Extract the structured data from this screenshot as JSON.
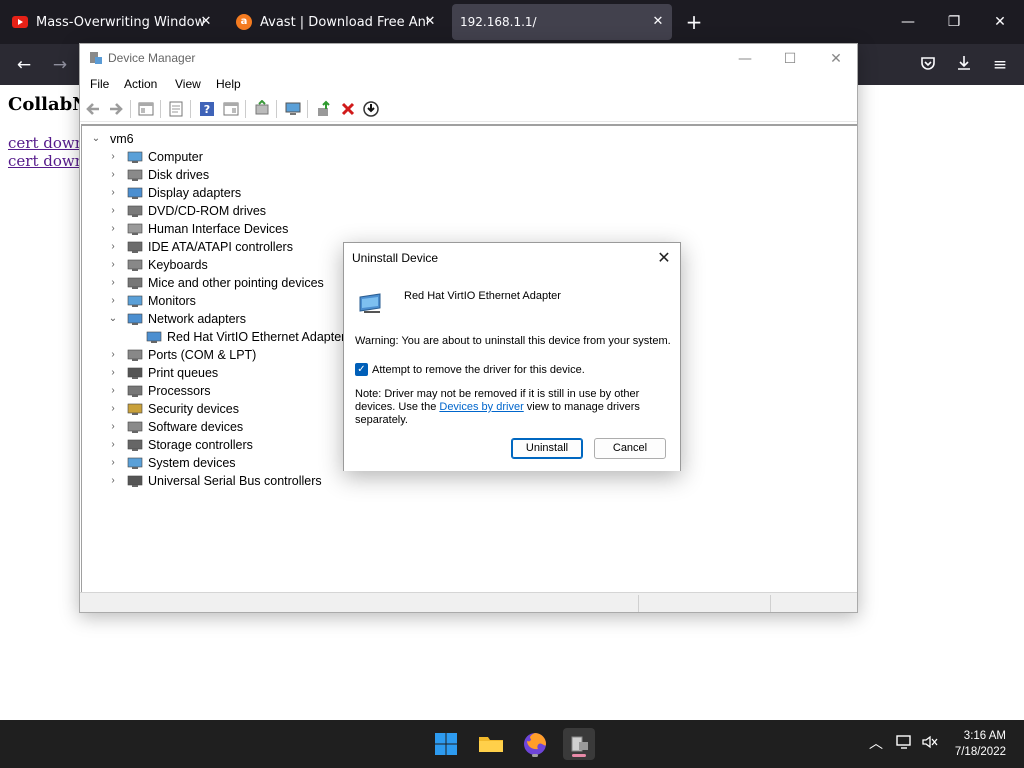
{
  "browser": {
    "tabs": [
      {
        "title": "Mass-Overwriting Windows Re",
        "icon": "youtube-icon"
      },
      {
        "title": "Avast | Download Free Antivirus",
        "icon": "avast-icon"
      },
      {
        "title": "192.168.1.1/",
        "icon": "none"
      }
    ]
  },
  "page": {
    "title": "CollabNe",
    "links": [
      "cert downlo",
      "cert downlo"
    ]
  },
  "device_manager": {
    "title": "Device Manager",
    "menu": [
      "File",
      "Action",
      "View",
      "Help"
    ],
    "root": "vm6",
    "categories": [
      {
        "label": "Computer",
        "expanded": false
      },
      {
        "label": "Disk drives",
        "expanded": false
      },
      {
        "label": "Display adapters",
        "expanded": false
      },
      {
        "label": "DVD/CD-ROM drives",
        "expanded": false
      },
      {
        "label": "Human Interface Devices",
        "expanded": false
      },
      {
        "label": "IDE ATA/ATAPI controllers",
        "expanded": false
      },
      {
        "label": "Keyboards",
        "expanded": false
      },
      {
        "label": "Mice and other pointing devices",
        "expanded": false
      },
      {
        "label": "Monitors",
        "expanded": false
      },
      {
        "label": "Network adapters",
        "expanded": true
      },
      {
        "label": "Red Hat VirtIO Ethernet Adapter",
        "child": true
      },
      {
        "label": "Ports (COM & LPT)",
        "expanded": false
      },
      {
        "label": "Print queues",
        "expanded": false
      },
      {
        "label": "Processors",
        "expanded": false
      },
      {
        "label": "Security devices",
        "expanded": false
      },
      {
        "label": "Software devices",
        "expanded": false
      },
      {
        "label": "Storage controllers",
        "expanded": false
      },
      {
        "label": "System devices",
        "expanded": false
      },
      {
        "label": "Universal Serial Bus controllers",
        "expanded": false
      }
    ]
  },
  "dialog": {
    "title": "Uninstall Device",
    "device_name": "Red Hat VirtIO Ethernet Adapter",
    "warning": "Warning: You are about to uninstall this device from your system.",
    "checkbox_label": "Attempt to remove the driver for this device.",
    "checkbox_checked": true,
    "note_before": "Note: Driver may not be removed if it is still in use by other devices. Use the ",
    "note_link": "Devices by driver",
    "note_after": " view to manage drivers separately.",
    "uninstall_label": "Uninstall",
    "cancel_label": "Cancel"
  },
  "taskbar": {
    "time": "3:16 AM",
    "date": "7/18/2022"
  }
}
